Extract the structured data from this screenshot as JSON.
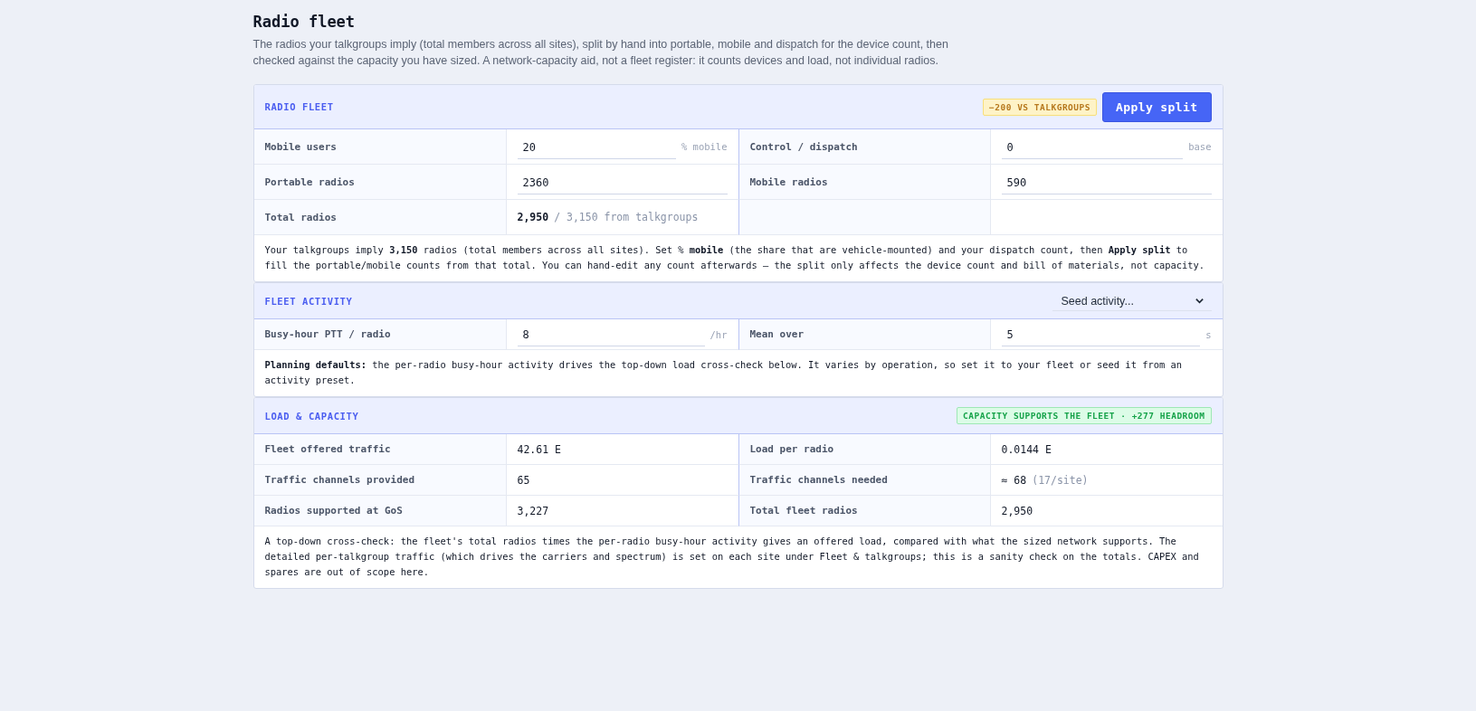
{
  "page": {
    "title": "Radio fleet",
    "description": "The radios your talkgroups imply (total members across all sites), split by hand into portable, mobile and dispatch for the device count, then checked against the capacity you have sized. A network-capacity aid, not a fleet register: it counts devices and load, not individual radios."
  },
  "sections": [
    {
      "title": "RADIO FLEET",
      "badge": {
        "text": "−200 VS TALKGROUPS",
        "kind": "warning"
      },
      "button": "Apply split",
      "rows": [
        [
          {
            "label": "Mobile users",
            "kind": "input",
            "value": "20",
            "unit": "% mobile"
          },
          {
            "label": "Control / dispatch",
            "kind": "input",
            "value": "0",
            "unit": "base"
          }
        ],
        [
          {
            "label": "Portable radios",
            "kind": "input",
            "value": "2360"
          },
          {
            "label": "Mobile radios",
            "kind": "input",
            "value": "590"
          }
        ],
        [
          {
            "label": "Total radios",
            "kind": "text",
            "value": "2,950",
            "strong": true,
            "note": "/ 3,150 from talkgroups"
          }
        ]
      ],
      "note": "Your talkgroups imply **3,150** radios (total members across all sites). Set % **mobile** (the share that are vehicle-mounted) and your dispatch count, then **Apply split** to fill the portable/mobile counts from that total. You can hand-edit any count afterwards — the split only affects the device count and bill of materials, not capacity."
    },
    {
      "title": "FLEET ACTIVITY",
      "select": "Seed activity...",
      "rows": [
        [
          {
            "label": "Busy-hour PTT / radio",
            "kind": "input",
            "value": "8",
            "unit": "/hr"
          },
          {
            "label": "Mean over",
            "kind": "input",
            "value": "5",
            "unit": "s"
          }
        ]
      ],
      "note": "**Planning defaults:** the per-radio busy-hour activity drives the top-down load cross-check below. It varies by operation, so set it to your fleet or seed it from an activity preset."
    },
    {
      "title": "LOAD & CAPACITY",
      "badge": {
        "text": "CAPACITY SUPPORTS THE FLEET · +277 HEADROOM",
        "kind": "ok"
      },
      "rows": [
        [
          {
            "label": "Fleet offered traffic",
            "kind": "text",
            "value": "42.61 E"
          },
          {
            "label": "Load per radio",
            "kind": "text",
            "value": "0.0144 E"
          }
        ],
        [
          {
            "label": "Traffic channels provided",
            "kind": "text",
            "value": "65"
          },
          {
            "label": "Traffic channels needed",
            "kind": "text",
            "value": "≈ 68",
            "note": "(17/site)"
          }
        ],
        [
          {
            "label": "Radios supported at GoS",
            "kind": "text",
            "value": "3,227"
          },
          {
            "label": "Total fleet radios",
            "kind": "text",
            "value": "2,950"
          }
        ]
      ],
      "note": "A top-down cross-check: the fleet's total radios times the per-radio busy-hour activity gives an offered load, compared with what the sized network supports. The detailed per-talkgroup traffic (which drives the carriers and spectrum) is set on each site under Fleet & talkgroups; this is a sanity check on the totals. CAPEX and spares are out of scope here."
    }
  ]
}
